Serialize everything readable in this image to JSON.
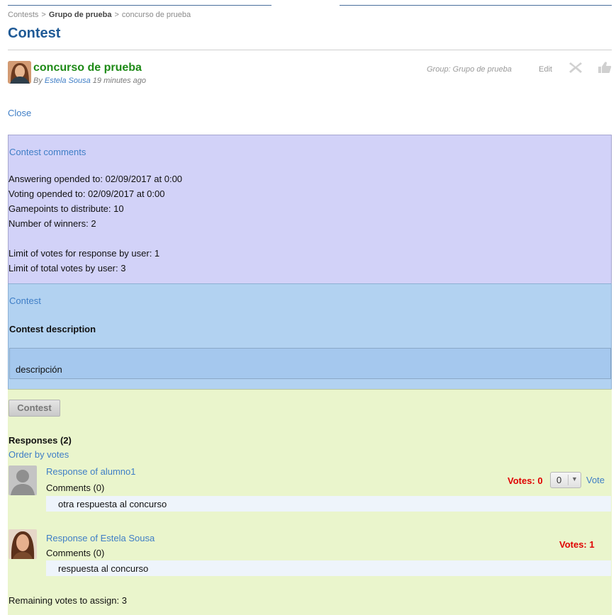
{
  "breadcrumb": {
    "item1": "Contests",
    "item2": "Grupo de prueba",
    "item3": "concurso de prueba",
    "separator": ">"
  },
  "page_title": "Contest",
  "entity": {
    "title": "concurso de prueba",
    "by_prefix": "By",
    "author": "Estela Sousa",
    "time": "19 minutes ago"
  },
  "actions": {
    "group": "Group: Grupo de prueba",
    "edit": "Edit",
    "icons": [
      "delete-icon",
      "like-icon"
    ]
  },
  "close_label": "Close",
  "comments_panel": {
    "heading": "Contest comments",
    "lines": [
      "Answering opended to: 02/09/2017 at 0:00",
      "Voting opended to: 02/09/2017 at 0:00",
      "Gamepoints to distribute: 10",
      "Number of winners: 2",
      "Limit of votes for response by user: 1",
      "Limit of total votes by user: 3"
    ]
  },
  "description_panel": {
    "heading": "Contest",
    "title": "Contest description",
    "text": "descripción"
  },
  "responses_panel": {
    "button": "Contest",
    "title": "Responses (2)",
    "order_link": "Order by votes",
    "items": [
      {
        "title": "Response of alumno1",
        "comments": "Comments (0)",
        "text": "otra respuesta al concurso",
        "votes": "Votes: 0",
        "select_value": "0",
        "vote_link": "Vote"
      },
      {
        "title": "Response of Estela Sousa",
        "comments": "Comments (0)",
        "text": "respuesta al concurso",
        "votes": "Votes: 1"
      }
    ],
    "remaining": "Remaining votes to assign: 3"
  },
  "colors": {
    "title_blue": "#1f5a96",
    "entity_green": "#1e8a17",
    "link_blue": "#3f7ec6",
    "comments_bg": "#d2d2f8",
    "description_bg": "#b2d2f1",
    "responses_bg": "#eaf5cc",
    "votes_red": "#e00000"
  }
}
